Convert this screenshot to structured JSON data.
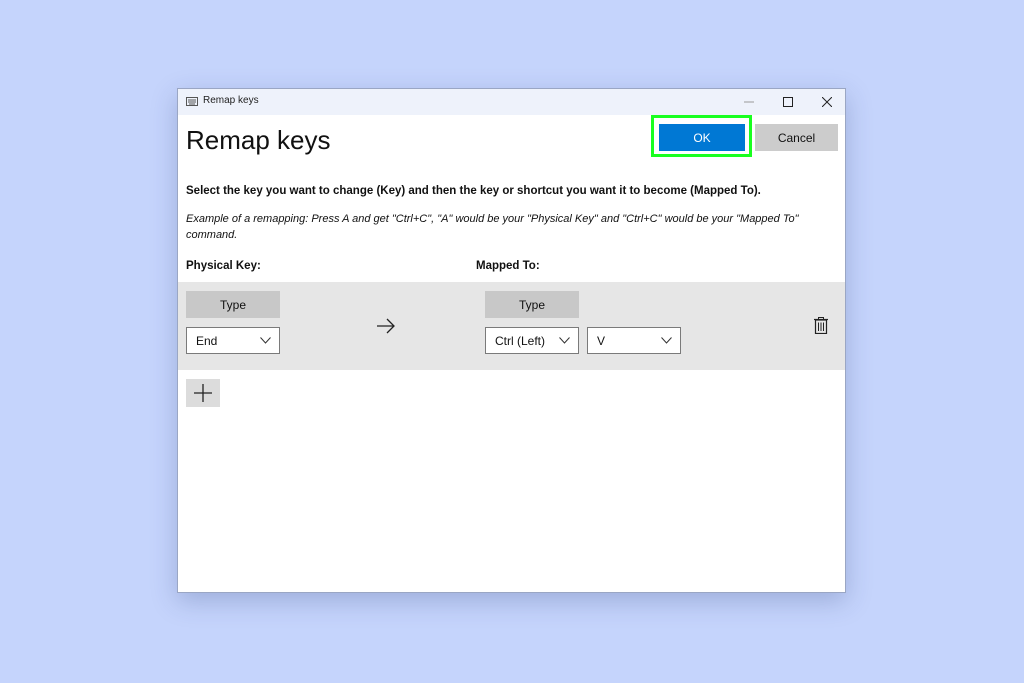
{
  "window": {
    "title": "Remap keys",
    "icon": "keyboard-icon",
    "controls": [
      "minimize-icon",
      "maximize-icon",
      "close-icon"
    ]
  },
  "header": {
    "heading": "Remap keys",
    "ok_label": "OK",
    "cancel_label": "Cancel"
  },
  "content": {
    "instruction": "Select the key you want to change (Key) and then the key or shortcut you want it to become (Mapped To).",
    "example": "Example of a remapping: Press A and get \"Ctrl+C\", \"A\" would be your \"Physical Key\" and \"Ctrl+C\" would be your \"Mapped To\" command.",
    "physical_key_label": "Physical Key:",
    "mapped_to_label": "Mapped To:"
  },
  "mapping": {
    "physical": {
      "type_label": "Type",
      "key": "End"
    },
    "mapped": {
      "type_label": "Type",
      "keys": [
        "Ctrl (Left)",
        "V"
      ]
    },
    "icons": {
      "arrow": "arrow-right-icon",
      "delete": "trash-icon",
      "add": "plus-icon"
    }
  },
  "colors": {
    "background": "#c5d4fc",
    "accent": "#0078d4",
    "highlight": "#19ff1f",
    "row_background": "#e6e6e6"
  }
}
